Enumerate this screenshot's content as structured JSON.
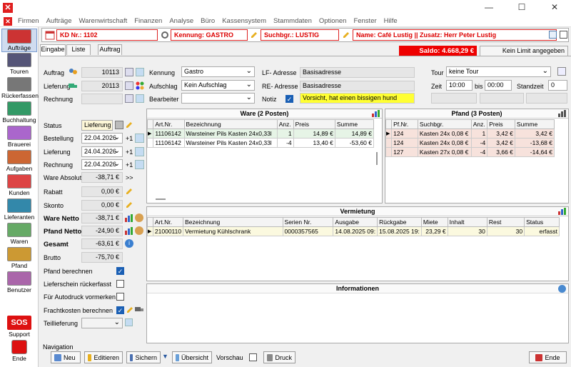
{
  "window": {
    "min": "—",
    "max": "☐",
    "close": "✕"
  },
  "menu": [
    "Firmen",
    "Aufträge",
    "Warenwirtschaft",
    "Finanzen",
    "Analyse",
    "Büro",
    "Kassensystem",
    "Stammdaten",
    "Optionen",
    "Fenster",
    "Hilfe"
  ],
  "sidebar": [
    {
      "label": "Aufträge",
      "color": "#c33"
    },
    {
      "label": "Touren",
      "color": "#557"
    },
    {
      "label": "Rückerfassen",
      "color": "#777"
    },
    {
      "label": "Buchhaltung",
      "color": "#396"
    },
    {
      "label": "Brauerei",
      "color": "#a6c"
    },
    {
      "label": "Aufgaben",
      "color": "#c63"
    },
    {
      "label": "Kunden",
      "color": "#d44"
    },
    {
      "label": "Lieferanten",
      "color": "#38a"
    },
    {
      "label": "Waren",
      "color": "#6a6"
    },
    {
      "label": "Pfand",
      "color": "#c93"
    },
    {
      "label": "Benutzer",
      "color": "#a6a"
    },
    {
      "label": "Support",
      "color": "#d11"
    },
    {
      "label": "Ende",
      "color": "#d11"
    }
  ],
  "support_text": "SOS",
  "info": {
    "kd": "KD Nr.: 1102",
    "kennung": "Kennung: GASTRO",
    "suchbgr": "Suchbgr.: LUSTIG",
    "name": "Name: Café Lustig || Zusatz: Herr Peter Lustig"
  },
  "tabs": [
    "Eingabe",
    "Liste",
    "Auftrag"
  ],
  "saldo": "Saldo: 4.668,29 €",
  "limit": "Kein Limit angegeben",
  "form": {
    "auftrag_label": "Auftrag",
    "auftrag": "10113",
    "lieferung_label": "Lieferung",
    "lieferung": "20113",
    "rechnung_label": "Rechnung",
    "rechnung": "",
    "status_label": "Status",
    "status": "Lieferung",
    "bestellung_label": "Bestellung",
    "bestellung": "22.04.2026",
    "lieferung_date_label": "Lieferung",
    "lieferung_date": "24.04.2026",
    "rechnung_date_label": "Rechnung",
    "rechnung_date": "22.04.2026",
    "plus": "+1",
    "ware_absolut_label": "Ware Absolut",
    "ware_absolut": "-38,71 €",
    "arrows": ">>",
    "rabatt_label": "Rabatt",
    "rabatt": "0,00 €",
    "skonto_label": "Skonto",
    "skonto": "0,00 €",
    "ware_netto_label": "Ware Netto",
    "ware_netto": "-38,71 €",
    "pfand_netto_label": "Pfand Netto",
    "pfand_netto": "-24,90 €",
    "gesamt_label": "Gesamt",
    "gesamt": "-63,61 €",
    "brutto_label": "Brutto",
    "brutto": "-75,70 €",
    "pfand_berechnen": "Pfand berechnen",
    "lieferschein": "Lieferschein rückerfasst",
    "autodruck": "Für Autodruck vormerken",
    "fracht": "Frachtkosten berechnen",
    "teillieferung": "Teillieferung"
  },
  "mid": {
    "kennung_label": "Kennung",
    "kennung": "Gastro",
    "aufschlag_label": "Aufschlag",
    "aufschlag": "Kein Aufschlag",
    "bearbeiter_label": "Bearbeiter",
    "bearbeiter": "",
    "lf_label": "LF- Adresse",
    "lf": "Basisadresse",
    "re_label": "RE- Adresse",
    "re": "Basisadresse",
    "notiz_label": "Notiz",
    "notiz": "Vorsicht, hat einen bissigen hund",
    "tour_label": "Tour",
    "tour": "keine Tour",
    "zeit_label": "Zeit",
    "zeit_von": "10:00",
    "bis_label": "bis",
    "zeit_bis": "00:00",
    "standzeit_label": "Standzeit",
    "standzeit": "0"
  },
  "ware": {
    "title": "Ware (2 Posten)",
    "cols": [
      "Art.Nr.",
      "Bezeichnung",
      "Anz.",
      "Preis",
      "Summe"
    ],
    "rows": [
      [
        "11106142",
        "Warsteiner Pils Kasten 24x0,33l",
        "1",
        "14,89 €",
        "14,89 €"
      ],
      [
        "11106142",
        "Warsteiner Pils Kasten 24x0,33l",
        "-4",
        "13,40 €",
        "-53,60 €"
      ]
    ]
  },
  "pfand": {
    "title": "Pfand (3 Posten)",
    "cols": [
      "Pf.Nr.",
      "Suchbgr.",
      "Anz.",
      "Preis",
      "Summe"
    ],
    "rows": [
      [
        "124",
        "Kasten 24x 0,08 €",
        "1",
        "3,42 €",
        "3,42 €"
      ],
      [
        "124",
        "Kasten 24x 0,08 €",
        "-4",
        "3,42 €",
        "-13,68 €"
      ],
      [
        "127",
        "Kasten 27x 0,08 €",
        "-4",
        "3,66 €",
        "-14,64 €"
      ]
    ]
  },
  "vermietung": {
    "title": "Vermietung",
    "cols": [
      "Art.Nr.",
      "Bezeichnung",
      "Serien Nr.",
      "Ausgabe",
      "Rückgabe",
      "Miete",
      "Inhalt",
      "Rest",
      "Status"
    ],
    "rows": [
      [
        "21000110",
        "Vermietung Kühlschrank",
        "0000357565",
        "14.08.2025 09:",
        "15.08.2025 19:",
        "23,29 €",
        "30",
        "30",
        "erfasst"
      ]
    ]
  },
  "informationen": "Informationen",
  "nav": {
    "label": "Navigation",
    "neu": "Neu",
    "editieren": "Editieren",
    "sichern": "Sichern",
    "uebersicht": "Übersicht",
    "vorschau": "Vorschau",
    "druck": "Druck",
    "ende": "Ende"
  }
}
